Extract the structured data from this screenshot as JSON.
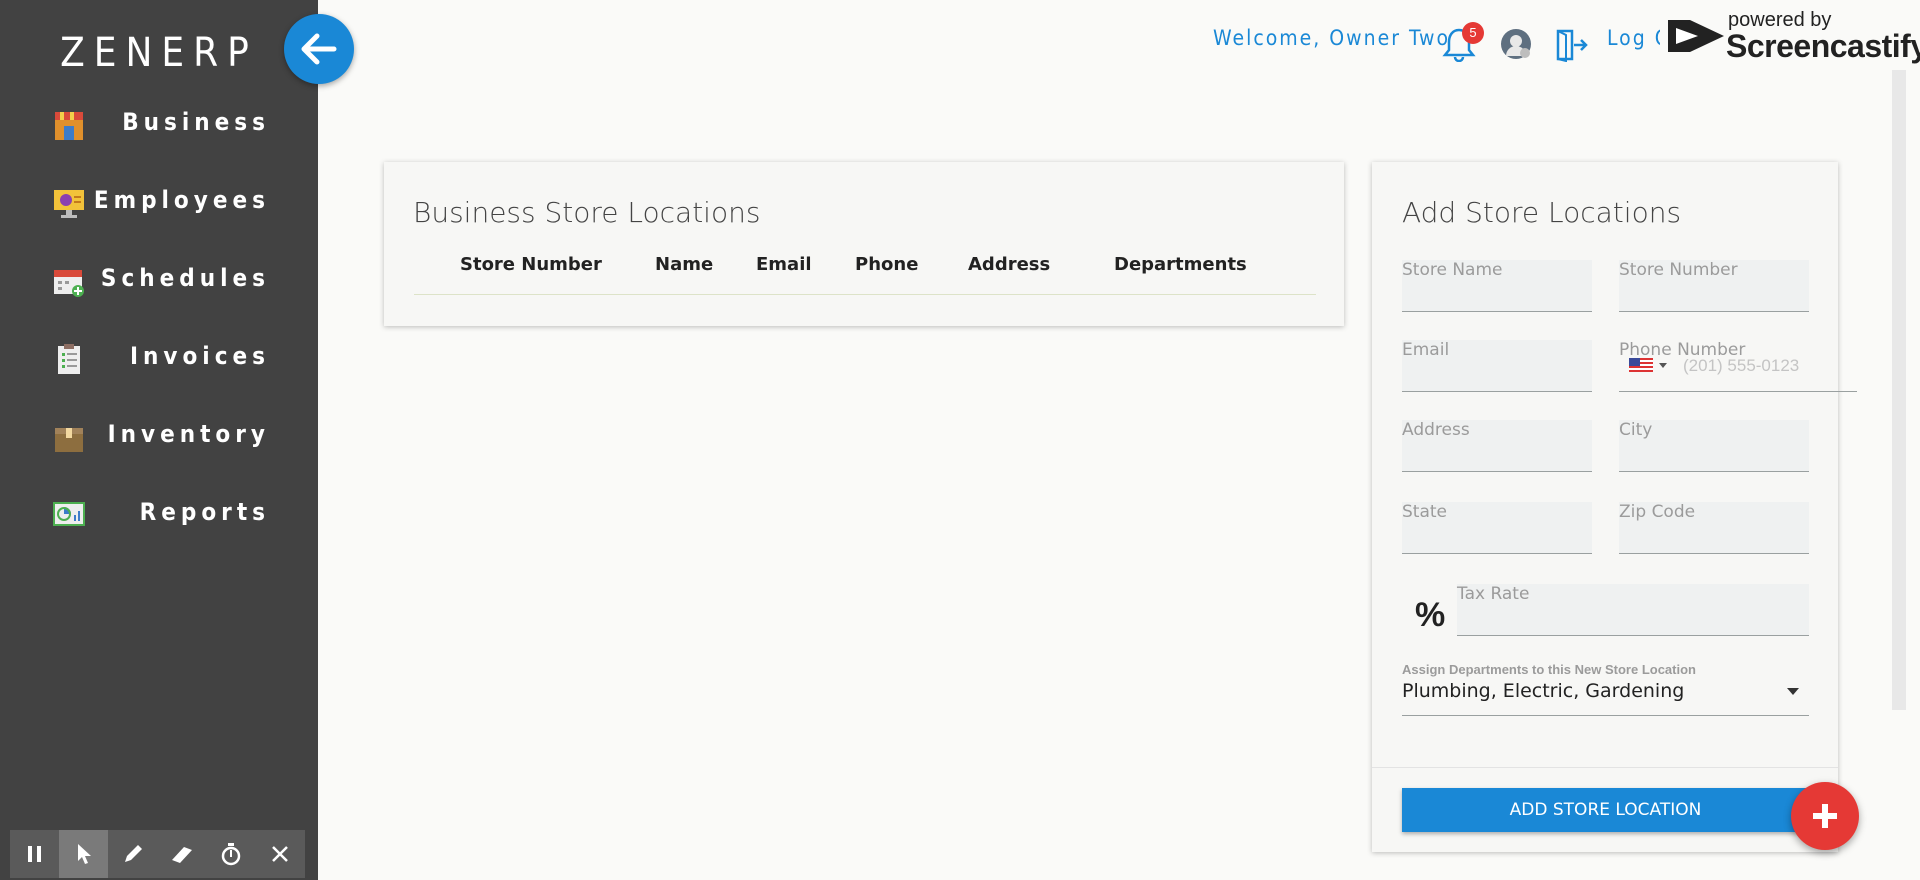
{
  "app": {
    "logo": "ZENERP"
  },
  "sidebar": {
    "items": [
      {
        "label": "Business",
        "icon": "store-icon"
      },
      {
        "label": "Employees",
        "icon": "monitor-icon"
      },
      {
        "label": "Schedules",
        "icon": "calendar-icon"
      },
      {
        "label": "Invoices",
        "icon": "clipboard-icon"
      },
      {
        "label": "Inventory",
        "icon": "box-icon"
      },
      {
        "label": "Reports",
        "icon": "chart-icon"
      }
    ]
  },
  "header": {
    "welcome": "Welcome, Owner Two",
    "notification_count": "5",
    "logout": "Log O"
  },
  "watermark": {
    "powered": "powered by",
    "name": "Screencastify"
  },
  "locations_card": {
    "title": "Business Store Locations",
    "columns": [
      "Store Number",
      "Name",
      "Email",
      "Phone",
      "Address",
      "Departments"
    ]
  },
  "form": {
    "title": "Add Store Locations",
    "store_name": "Store Name",
    "store_number": "Store Number",
    "email": "Email",
    "phone_label": "Phone Number",
    "phone_placeholder": "(201) 555-0123",
    "address": "Address",
    "city": "City",
    "state": "State",
    "zip": "Zip Code",
    "tax_symbol": "%",
    "tax_rate": "Tax Rate",
    "departments_label": "Assign Departments to this New Store Location",
    "departments_value": "Plumbing, Electric, Gardening",
    "submit": "ADD STORE LOCATION"
  },
  "colors": {
    "accent": "#1a88d6",
    "sidebar": "#424242",
    "fab": "#e53935"
  }
}
